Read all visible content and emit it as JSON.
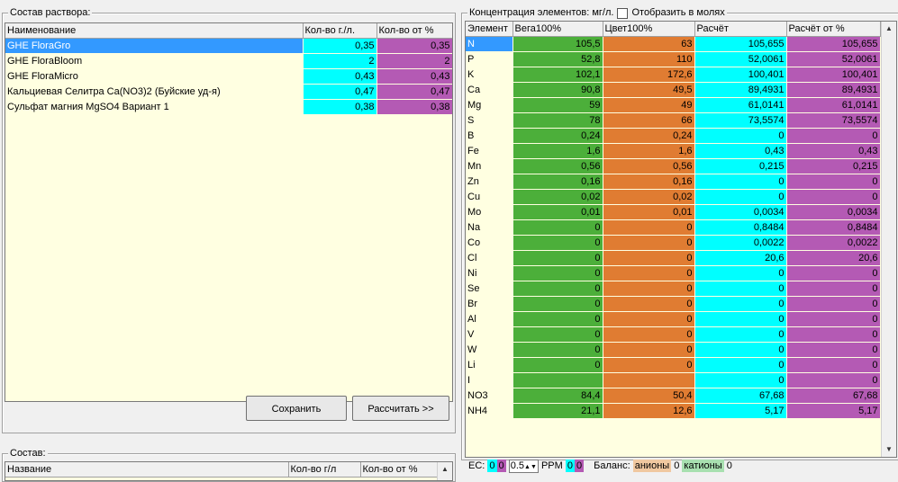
{
  "solution_panel": {
    "title": "Состав раствора:",
    "columns": [
      "Наименование",
      "Кол-во г./л.",
      "Кол-во от %"
    ],
    "rows": [
      {
        "name": "GHE FloraGro",
        "qty": "0,35",
        "pct": "0,35"
      },
      {
        "name": "GHE FloraBloom",
        "qty": "2",
        "pct": "2"
      },
      {
        "name": "GHE FloraMicro",
        "qty": "0,43",
        "pct": "0,43"
      },
      {
        "name": "Кальциевая Селитра Ca(NO3)2 (Буйские уд-я)",
        "qty": "0,47",
        "pct": "0,47"
      },
      {
        "name": "Сульфат магния MgSO4 Вариант 1",
        "qty": "0,38",
        "pct": "0,38"
      }
    ],
    "save_label": "Сохранить",
    "calc_label": "Рассчитать >>"
  },
  "composition_panel": {
    "title": "Состав:",
    "columns": [
      "Название",
      "Кол-во г/л",
      "Кол-во от %"
    ]
  },
  "elements_panel": {
    "title": "Концентрация элементов: мг/л.",
    "moles_label": "Отобразить в молях",
    "columns": [
      "Элемент",
      "Вега100%",
      "Цвет100%",
      "Расчёт",
      "Расчёт от %"
    ],
    "rows": [
      {
        "el": "N",
        "vega": "105,5",
        "cvet": "63",
        "calc": "105,655",
        "pct": "105,655"
      },
      {
        "el": "P",
        "vega": "52,8",
        "cvet": "110",
        "calc": "52,0061",
        "pct": "52,0061"
      },
      {
        "el": "K",
        "vega": "102,1",
        "cvet": "172,6",
        "calc": "100,401",
        "pct": "100,401"
      },
      {
        "el": "Ca",
        "vega": "90,8",
        "cvet": "49,5",
        "calc": "89,4931",
        "pct": "89,4931"
      },
      {
        "el": "Mg",
        "vega": "59",
        "cvet": "49",
        "calc": "61,0141",
        "pct": "61,0141"
      },
      {
        "el": "S",
        "vega": "78",
        "cvet": "66",
        "calc": "73,5574",
        "pct": "73,5574"
      },
      {
        "el": "B",
        "vega": "0,24",
        "cvet": "0,24",
        "calc": "0",
        "pct": "0"
      },
      {
        "el": "Fe",
        "vega": "1,6",
        "cvet": "1,6",
        "calc": "0,43",
        "pct": "0,43"
      },
      {
        "el": "Mn",
        "vega": "0,56",
        "cvet": "0,56",
        "calc": "0,215",
        "pct": "0,215"
      },
      {
        "el": "Zn",
        "vega": "0,16",
        "cvet": "0,16",
        "calc": "0",
        "pct": "0"
      },
      {
        "el": "Cu",
        "vega": "0,02",
        "cvet": "0,02",
        "calc": "0",
        "pct": "0"
      },
      {
        "el": "Mo",
        "vega": "0,01",
        "cvet": "0,01",
        "calc": "0,0034",
        "pct": "0,0034"
      },
      {
        "el": "Na",
        "vega": "0",
        "cvet": "0",
        "calc": "0,8484",
        "pct": "0,8484"
      },
      {
        "el": "Co",
        "vega": "0",
        "cvet": "0",
        "calc": "0,0022",
        "pct": "0,0022"
      },
      {
        "el": "Cl",
        "vega": "0",
        "cvet": "0",
        "calc": "20,6",
        "pct": "20,6"
      },
      {
        "el": "Ni",
        "vega": "0",
        "cvet": "0",
        "calc": "0",
        "pct": "0"
      },
      {
        "el": "Se",
        "vega": "0",
        "cvet": "0",
        "calc": "0",
        "pct": "0"
      },
      {
        "el": "Br",
        "vega": "0",
        "cvet": "0",
        "calc": "0",
        "pct": "0"
      },
      {
        "el": "Al",
        "vega": "0",
        "cvet": "0",
        "calc": "0",
        "pct": "0"
      },
      {
        "el": "V",
        "vega": "0",
        "cvet": "0",
        "calc": "0",
        "pct": "0"
      },
      {
        "el": "W",
        "vega": "0",
        "cvet": "0",
        "calc": "0",
        "pct": "0"
      },
      {
        "el": "Li",
        "vega": "0",
        "cvet": "0",
        "calc": "0",
        "pct": "0"
      },
      {
        "el": "I",
        "vega": "",
        "cvet": "",
        "calc": "0",
        "pct": "0"
      },
      {
        "el": "NO3",
        "vega": "84,4",
        "cvet": "50,4",
        "calc": "67,68",
        "pct": "67,68"
      },
      {
        "el": "NH4",
        "vega": "21,1",
        "cvet": "12,6",
        "calc": "5,17",
        "pct": "5,17"
      }
    ]
  },
  "status": {
    "ec_label": "EC:",
    "ec_val1": "0",
    "ec_val2": "0",
    "spin_value": "0.5",
    "ppm_label": "PPM",
    "ppm_val1": "0",
    "ppm_val2": "0",
    "balance_label": "Баланс:",
    "anions_label": "анионы",
    "anions_val": "0",
    "cations_label": "катионы",
    "cations_val": "0"
  },
  "colors": {
    "cyan": "#00ffff",
    "purple": "#b45ab4",
    "green": "#4caf3a",
    "orange": "#e07c32",
    "selection": "#3399ff",
    "grid_bg": "#ffffe1"
  }
}
